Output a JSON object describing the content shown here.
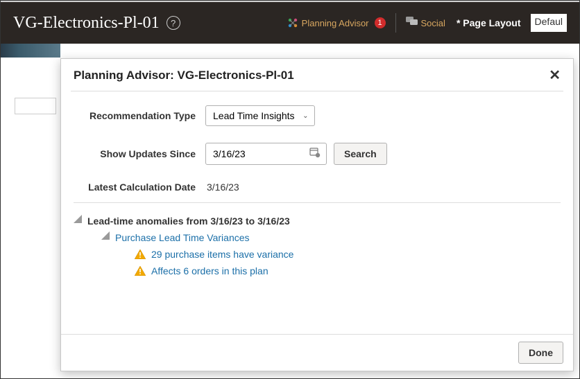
{
  "header": {
    "page_title": "VG-Electronics-Pl-01",
    "planning_advisor_label": "Planning Advisor",
    "planning_advisor_badge": "1",
    "social_label": "Social",
    "page_layout_label": "* Page Layout",
    "layout_value": "Defaul"
  },
  "dialog": {
    "title": "Planning Advisor: VG-Electronics-Pl-01",
    "fields": {
      "recommendation_type_label": "Recommendation Type",
      "recommendation_type_value": "Lead Time Insights",
      "show_updates_label": "Show Updates Since",
      "show_updates_value": "3/16/23",
      "search_button": "Search",
      "latest_calc_label": "Latest Calculation Date",
      "latest_calc_value": "3/16/23"
    },
    "tree": {
      "root_label": "Lead-time anomalies from 3/16/23 to 3/16/23",
      "child_label": "Purchase Lead Time Variances",
      "leaf1": "29 purchase items have variance",
      "leaf2": "Affects 6 orders in this plan"
    },
    "done_button": "Done"
  }
}
